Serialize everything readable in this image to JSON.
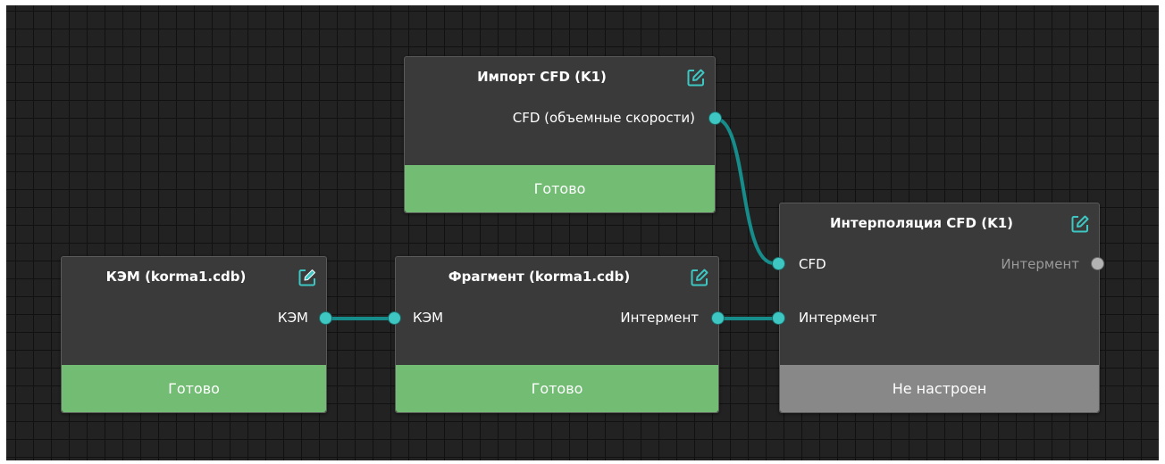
{
  "nodes": {
    "import_cfd": {
      "title": "Импорт CFD (K1)",
      "output_label": "CFD (объемные скорости)",
      "status": "Готово"
    },
    "kem": {
      "title": "КЭМ (korma1.cdb)",
      "output_label": "КЭМ",
      "status": "Готово"
    },
    "fragment": {
      "title": "Фрагмент (korma1.cdb)",
      "input_label": "КЭМ",
      "output_label": "Интермент",
      "status": "Готово"
    },
    "interpolation": {
      "title": "Интерполяция CFD (K1)",
      "input_cfd_label": "CFD",
      "input_interment_label": "Интермент",
      "output_label": "Интермент",
      "status": "Не настроен"
    }
  },
  "colors": {
    "canvas": "#222222",
    "grid": "#111111",
    "node_body": "#3a3a3a",
    "status_ready": "#72bc74",
    "status_not_configured": "#888888",
    "port_connected": "#3dc6c2",
    "port_unconnected": "#b3b3b3",
    "wire": "#168d8b",
    "edit_icon_active": "#3dc6c2"
  },
  "icons": {
    "edit": "edit-icon"
  }
}
